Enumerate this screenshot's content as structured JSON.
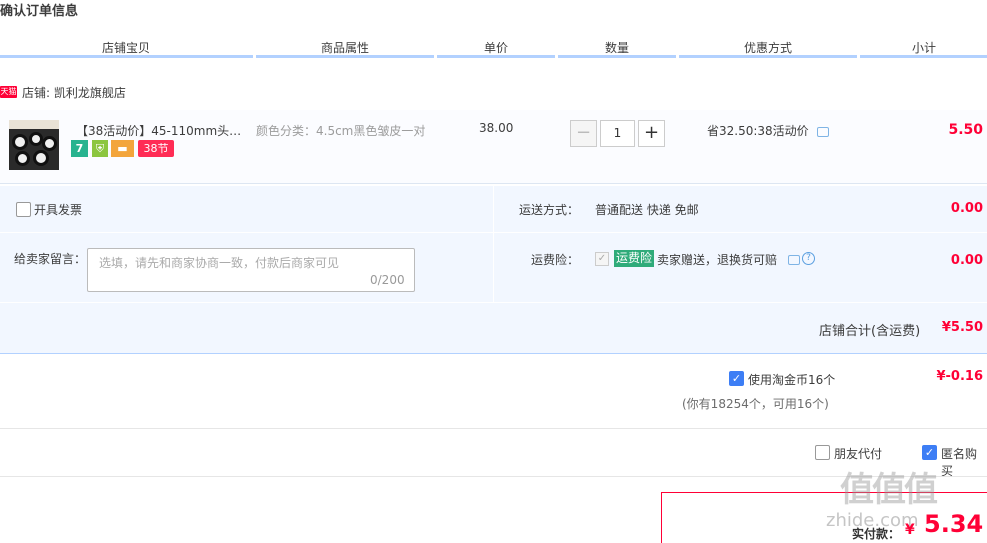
{
  "page_title": "确认订单信息",
  "columns": [
    "店铺宝贝",
    "商品属性",
    "单价",
    "数量",
    "优惠方式",
    "小计"
  ],
  "shop": {
    "tag": "天猫",
    "name": "店铺: 凯利龙旗舰店"
  },
  "item": {
    "name": "【38活动价】45-110mm头戴...",
    "badges": [
      "7",
      "⛨",
      "▬",
      "38节"
    ],
    "attribute": "颜色分类：4.5cm黑色皱皮一对",
    "price": "38.00",
    "qty_minus": "−",
    "quantity": "1",
    "qty_plus": "+",
    "promo": "省32.50:38活动价",
    "subtotal": "5.50"
  },
  "invoice": {
    "label": "开具发票"
  },
  "shipping": {
    "label": "运送方式：",
    "value": "普通配送 快递 免邮",
    "fee": "0.00"
  },
  "note": {
    "label": "给卖家留言：",
    "placeholder": "选填，请先和商家协商一致，付款后商家可见",
    "counter": "0/200"
  },
  "insurance": {
    "label": "运费险：",
    "check": "✓",
    "tag": "运费险",
    "text": "卖家赠送，退换货可赔",
    "help": "?",
    "fee": "0.00"
  },
  "shop_total": {
    "label": "店铺合计(含运费)",
    "value": "¥5.50"
  },
  "coins": {
    "check": "✓",
    "label": "使用淘金币16个",
    "amount": "¥-0.16",
    "note": "(你有18254个，可用16个)"
  },
  "friend_pay": {
    "label": "朋友代付"
  },
  "anonymous": {
    "check": "✓",
    "label": "匿名购买"
  },
  "payment": {
    "label": "实付款：",
    "currency": "¥",
    "amount": "5.34"
  },
  "watermark": {
    "glyphs": "值值值",
    "site": "zhide.com"
  },
  "colors": {
    "accent": "#ff0036",
    "blue": "#3d7ef5",
    "header_rule": "#b2d1ff",
    "panel": "#f2f7ff"
  }
}
